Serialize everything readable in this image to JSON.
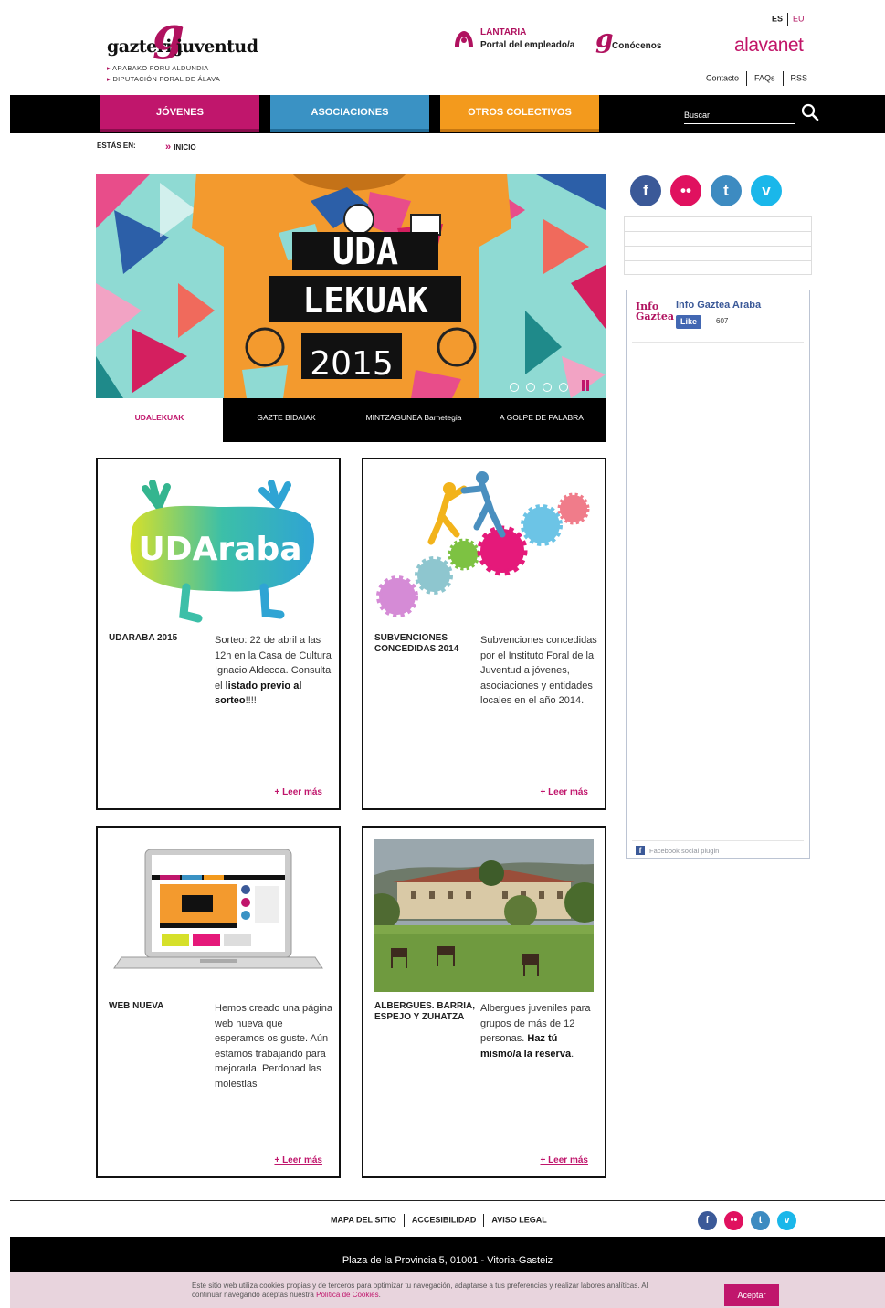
{
  "header": {
    "logo_word1": "gazteria",
    "logo_word2": "juventud",
    "logo_sub1": "ARABAKO FORU ALDUNDIA",
    "logo_sub2": "DIPUTACIÓN FORAL DE ÁLAVA",
    "lantaria_title": "LANTARIA",
    "lantaria_sub": "Portal del empleado/a",
    "conocenos": "Conócenos",
    "lang_es": "ES",
    "lang_eu": "EU",
    "alavanet": "alavanet",
    "links": [
      "Contacto",
      "FAQs",
      "RSS"
    ]
  },
  "nav": {
    "tabs": [
      "JÓVENES",
      "ASOCIACIONES",
      "OTROS COLECTIVOS"
    ],
    "search_placeholder": "Buscar",
    "colors": {
      "jovenes": "#c0166c",
      "asociaciones": "#3a92c4",
      "otros": "#f39a1d"
    }
  },
  "breadcrumb": {
    "label": "ESTÁS EN:",
    "home": "INICIO"
  },
  "slider": {
    "line1": "UDA",
    "line2": "LEKUAK",
    "year": "2015",
    "tabs": [
      "UDALEKUAK",
      "GAZTE BIDAIAK",
      "MINTZAGUNEA Barnetegia",
      "A GOLPE DE PALABRA"
    ]
  },
  "cards": [
    {
      "title": "UDARABA 2015",
      "image_text": "UDAraba",
      "text_plain": "Sorteo: 22 de abril a las 12h en la Casa de Cultura Ignacio Aldecoa. Consulta el ",
      "text_bold": "listado previo al sorteo",
      "text_tail": "!!!!",
      "more": "+ Leer más"
    },
    {
      "title": "SUBVENCIONES CONCEDIDAS 2014",
      "text_plain": "Subvenciones concedidas por el Instituto Foral de la Juventud a jóvenes, asociaciones y entidades locales en el año 2014.",
      "more": "+ Leer más"
    },
    {
      "title": "WEB NUEVA",
      "text_plain": "Hemos creado una página web nueva que esperamos os guste. Aún estamos trabajando para mejorarla. Perdonad las molestias",
      "more": "+ Leer más"
    },
    {
      "title": "ALBERGUES. BARRIA, ESPEJO Y ZUHATZA",
      "text_plain": "Albergues juveniles para grupos de más de 12 personas. ",
      "text_bold": "Haz tú mismo/a la reserva",
      "text_tail": ".",
      "more": "+ Leer más"
    }
  ],
  "sidebar": {
    "social_icons": [
      "facebook-icon",
      "flickr-icon",
      "twitter-icon",
      "vimeo-icon"
    ],
    "fb_logo": "Info Gaztea",
    "fb_page_name": "Info Gaztea Araba",
    "fb_like": "Like",
    "fb_count": "607",
    "fb_plugin": "Facebook social plugin"
  },
  "footer": {
    "links": [
      "MAPA DEL SITIO",
      "ACCESIBILIDAD",
      "AVISO LEGAL"
    ],
    "address": "Plaza de la Provincia 5, 01001 - Vitoria-Gasteiz"
  },
  "cookie": {
    "text": "Este sitio web utiliza cookies propias y de terceros para optimizar tu navegación, adaptarse a tus preferencias y realizar labores analíticas. Al continuar navegando aceptas nuestra ",
    "policy_link": "Política de Cookies",
    "tail": ".",
    "accept": "Aceptar"
  }
}
